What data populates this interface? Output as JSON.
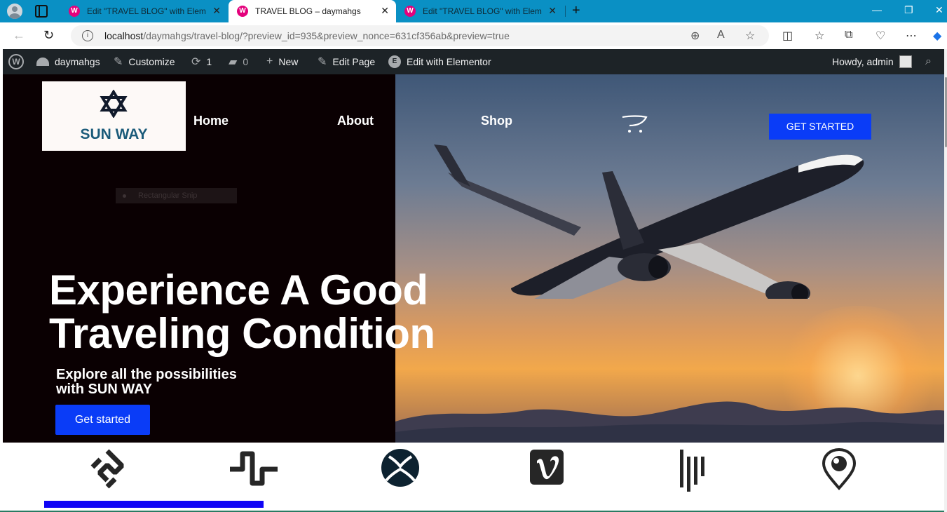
{
  "browser": {
    "tabs": [
      {
        "title": "Edit \"TRAVEL BLOG\" with Elementor",
        "active": false
      },
      {
        "title": "TRAVEL BLOG – daymahgs",
        "active": true
      },
      {
        "title": "Edit \"TRAVEL BLOG\" with Elementor",
        "active": false
      }
    ],
    "url_host": "localhost",
    "url_rest": "/daymahgs/travel-blog/?preview_id=935&preview_nonce=631cf356ab&preview=true",
    "colors": {
      "tabstrip": "#0a90c4",
      "favicon": "#e4007c"
    }
  },
  "wp_admin_bar": {
    "site_name": "daymahgs",
    "customize": "Customize",
    "updates_count": "1",
    "comments_count": "0",
    "new": "New",
    "edit_page": "Edit Page",
    "edit_elementor": "Edit with Elementor",
    "howdy": "Howdy, admin"
  },
  "site": {
    "logo_text": "SUN WAY",
    "nav": [
      "Home",
      "About",
      "Shop"
    ],
    "header_cta": "GET STARTED",
    "snip_overlay": "Rectangular Snip",
    "headline_line1": "Experience A Good",
    "headline_line2": "Traveling Condition",
    "sub_line1": "Explore all the possibilities",
    "sub_line2": "with SUN WAY",
    "hero_cta": "Get started",
    "brand_icons": [
      "squarespace-icon",
      "pulse-icon",
      "xbox-icon",
      "vimeo-icon",
      "gitlab-bars-icon",
      "periscope-icon"
    ],
    "colors": {
      "cta": "#0a3cf7",
      "logo_text": "#1b5b7a",
      "active_bar": "#0f04f5"
    }
  }
}
